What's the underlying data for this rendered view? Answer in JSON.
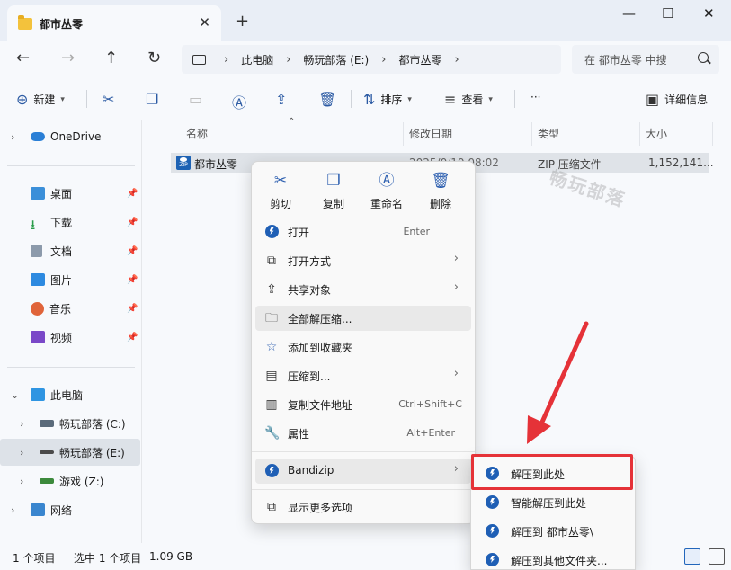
{
  "window": {
    "tab_title": "都市丛零",
    "tab_close": "✕",
    "new_tab": "+",
    "minimize": "—",
    "maximize": "☐",
    "close": "✕"
  },
  "nav": {
    "back": "←",
    "forward": "→",
    "up": "↑",
    "refresh": "↻"
  },
  "address": {
    "segments": [
      "此电脑",
      "畅玩部落 (E:)",
      "都市丛零"
    ],
    "chevron": "›"
  },
  "search": {
    "placeholder": "在 都市丛零 中搜"
  },
  "toolbar": {
    "new_label": "新建",
    "sort_label": "排序",
    "view_label": "查看",
    "more": "···",
    "details_label": "详细信息"
  },
  "sidebar": {
    "items": [
      {
        "label": "OneDrive"
      },
      {
        "label": "桌面"
      },
      {
        "label": "下载"
      },
      {
        "label": "文档"
      },
      {
        "label": "图片"
      },
      {
        "label": "音乐"
      },
      {
        "label": "视频"
      },
      {
        "label": "此电脑"
      },
      {
        "label": "畅玩部落 (C:)"
      },
      {
        "label": "畅玩部落 (E:)"
      },
      {
        "label": "游戏 (Z:)"
      },
      {
        "label": "网络"
      }
    ]
  },
  "columns": {
    "name": "名称",
    "modified": "修改日期",
    "type": "类型",
    "size": "大小"
  },
  "file": {
    "name": "都市丛零",
    "modified": "2025/0/10 08:02",
    "type": "ZIP 压缩文件",
    "size": "1,152,141..."
  },
  "watermark": "畅玩部落",
  "status": {
    "count": "1 个项目",
    "selected": "选中 1 个项目",
    "size": "1.09 GB"
  },
  "context_menu": {
    "quick": [
      {
        "label": "剪切",
        "icon": "scissors-icon"
      },
      {
        "label": "复制",
        "icon": "copy-icon"
      },
      {
        "label": "重命名",
        "icon": "rename-icon"
      },
      {
        "label": "删除",
        "icon": "delete-icon"
      }
    ],
    "items": [
      {
        "label": "打开",
        "shortcut": "Enter"
      },
      {
        "label": "打开方式"
      },
      {
        "label": "共享对象"
      },
      {
        "label": "全部解压缩..."
      },
      {
        "label": "添加到收藏夹"
      },
      {
        "label": "压缩到..."
      },
      {
        "label": "复制文件地址",
        "shortcut": "Ctrl+Shift+C"
      },
      {
        "label": "属性",
        "shortcut": "Alt+Enter"
      },
      {
        "label": "Bandizip"
      },
      {
        "label": "显示更多选项"
      }
    ]
  },
  "bandizip_submenu": {
    "items": [
      {
        "label": "解压到此处"
      },
      {
        "label": "智能解压到此处"
      },
      {
        "label": "解压到 都市丛零\\"
      },
      {
        "label": "解压到其他文件夹..."
      }
    ]
  },
  "colors": {
    "accent": "#1f5fb5",
    "highlight": "#e53238"
  }
}
